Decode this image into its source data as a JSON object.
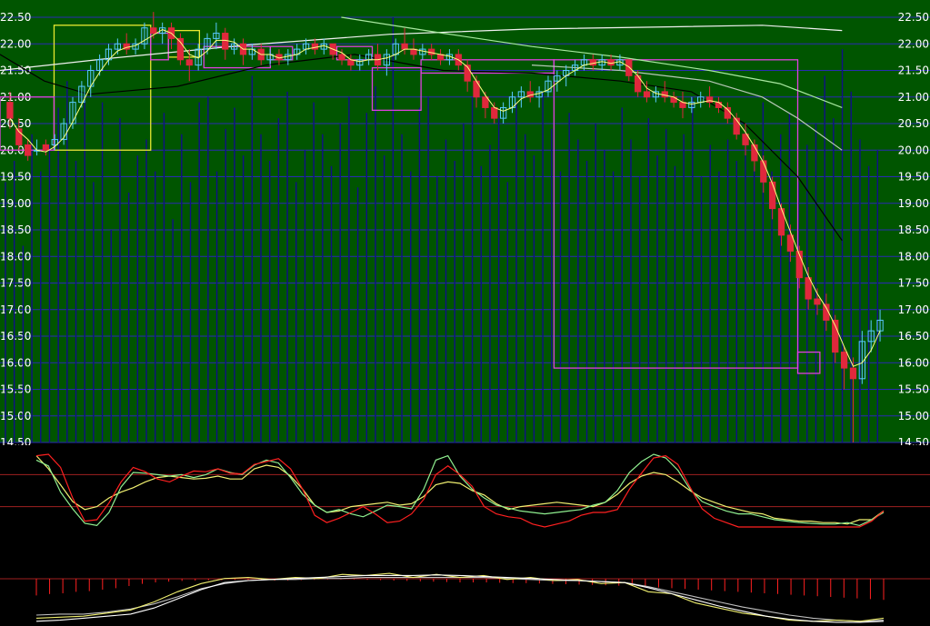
{
  "chart_data": {
    "type": "candlestick",
    "ylim": [
      14.5,
      22.5
    ],
    "grid": true,
    "yticks": [
      "14.50",
      "15.00",
      "15.50",
      "16.00",
      "16.50",
      "17.00",
      "17.50",
      "18.00",
      "18.50",
      "19.00",
      "19.50",
      "20.00",
      "20.50",
      "21.00",
      "21.50",
      "22.00",
      "22.50"
    ],
    "colors": {
      "background": "#005500",
      "gridline": "#2a2ab4",
      "candle_up": "#58c8ff",
      "candle_down": "#e0283c",
      "ma_white": "#f0f0f0",
      "ma_lightgreen": "#a8e8a0",
      "ma_black": "#000000",
      "ma_gray": "#b8c8b8",
      "ma_yellow": "#ffff80",
      "volume": "#101088",
      "box_yellow": "#e8e830",
      "box_magenta": "#e040e0",
      "osc_red": "#ff2020",
      "osc_green": "#90f090",
      "osc_yellow": "#f0f070",
      "osc_white": "#ffffff",
      "osc_refline": "#a02020"
    },
    "candles": [
      [
        20.9,
        21.1,
        20.6,
        20.4
      ],
      [
        20.4,
        20.6,
        20.1,
        20.0
      ],
      [
        20.1,
        20.2,
        19.9,
        19.8
      ],
      [
        20.0,
        20.2,
        20.0,
        19.9
      ],
      [
        20.1,
        20.2,
        20.0,
        19.9
      ],
      [
        20.1,
        20.3,
        20.2,
        20.0
      ],
      [
        20.2,
        20.6,
        20.5,
        20.1
      ],
      [
        20.5,
        21.0,
        20.9,
        20.4
      ],
      [
        20.9,
        21.3,
        21.2,
        20.8
      ],
      [
        21.2,
        21.6,
        21.5,
        21.0
      ],
      [
        21.5,
        21.8,
        21.7,
        21.4
      ],
      [
        21.7,
        22.0,
        21.9,
        21.6
      ],
      [
        21.9,
        22.1,
        22.0,
        21.8
      ],
      [
        22.0,
        22.2,
        21.9,
        21.8
      ],
      [
        21.9,
        22.1,
        22.0,
        21.8
      ],
      [
        22.0,
        22.4,
        22.3,
        21.9
      ],
      [
        22.3,
        22.6,
        22.2,
        22.1
      ],
      [
        22.2,
        22.4,
        22.3,
        22.0
      ],
      [
        22.3,
        22.4,
        22.1,
        21.9
      ],
      [
        22.1,
        22.2,
        21.7,
        21.6
      ],
      [
        21.7,
        21.9,
        21.6,
        21.3
      ],
      [
        21.6,
        22.0,
        21.9,
        21.5
      ],
      [
        21.9,
        22.2,
        22.1,
        21.8
      ],
      [
        22.1,
        22.4,
        22.2,
        21.9
      ],
      [
        22.2,
        22.3,
        21.9,
        21.7
      ],
      [
        21.9,
        22.1,
        22.0,
        21.8
      ],
      [
        22.0,
        22.1,
        21.8,
        21.6
      ],
      [
        21.8,
        22.0,
        21.9,
        21.7
      ],
      [
        21.9,
        22.0,
        21.7,
        21.6
      ],
      [
        21.7,
        21.9,
        21.8,
        21.6
      ],
      [
        21.8,
        21.9,
        21.7,
        21.6
      ],
      [
        21.7,
        21.9,
        21.8,
        21.6
      ],
      [
        21.8,
        22.0,
        21.9,
        21.7
      ],
      [
        21.9,
        22.1,
        22.0,
        21.8
      ],
      [
        22.0,
        22.1,
        21.9,
        21.8
      ],
      [
        21.9,
        22.1,
        22.0,
        21.8
      ],
      [
        22.0,
        22.0,
        21.8,
        21.7
      ],
      [
        21.8,
        21.9,
        21.7,
        21.6
      ],
      [
        21.7,
        21.8,
        21.6,
        21.5
      ],
      [
        21.6,
        21.8,
        21.7,
        21.5
      ],
      [
        21.7,
        21.9,
        21.8,
        21.6
      ],
      [
        21.8,
        22.0,
        21.6,
        21.5
      ],
      [
        21.6,
        21.9,
        21.8,
        21.4
      ],
      [
        21.8,
        22.1,
        22.0,
        21.7
      ],
      [
        22.0,
        22.3,
        21.9,
        21.8
      ],
      [
        21.9,
        22.1,
        21.8,
        21.7
      ],
      [
        21.8,
        22.0,
        21.9,
        21.7
      ],
      [
        21.9,
        22.0,
        21.8,
        21.7
      ],
      [
        21.8,
        21.9,
        21.7,
        21.6
      ],
      [
        21.7,
        21.9,
        21.8,
        21.6
      ],
      [
        21.8,
        21.9,
        21.6,
        21.5
      ],
      [
        21.6,
        21.7,
        21.3,
        21.1
      ],
      [
        21.3,
        21.4,
        21.0,
        20.8
      ],
      [
        21.0,
        21.1,
        20.8,
        20.6
      ],
      [
        20.8,
        20.9,
        20.6,
        20.5
      ],
      [
        20.6,
        20.9,
        20.8,
        20.5
      ],
      [
        20.8,
        21.1,
        21.0,
        20.7
      ],
      [
        21.0,
        21.2,
        21.1,
        20.8
      ],
      [
        21.1,
        21.3,
        21.0,
        20.9
      ],
      [
        21.0,
        21.2,
        21.1,
        20.8
      ],
      [
        21.1,
        21.4,
        21.3,
        21.0
      ],
      [
        21.3,
        21.5,
        21.4,
        21.1
      ],
      [
        21.4,
        21.6,
        21.5,
        21.2
      ],
      [
        21.5,
        21.7,
        21.6,
        21.4
      ],
      [
        21.6,
        21.8,
        21.7,
        21.5
      ],
      [
        21.7,
        21.8,
        21.6,
        21.5
      ],
      [
        21.6,
        21.8,
        21.7,
        21.5
      ],
      [
        21.7,
        21.8,
        21.6,
        21.5
      ],
      [
        21.6,
        21.8,
        21.7,
        21.5
      ],
      [
        21.7,
        21.7,
        21.4,
        21.3
      ],
      [
        21.4,
        21.5,
        21.1,
        21.0
      ],
      [
        21.1,
        21.3,
        21.0,
        20.9
      ],
      [
        21.0,
        21.2,
        21.1,
        20.9
      ],
      [
        21.1,
        21.3,
        21.0,
        20.9
      ],
      [
        21.0,
        21.1,
        20.9,
        20.8
      ],
      [
        20.9,
        21.1,
        20.8,
        20.6
      ],
      [
        20.8,
        21.0,
        20.9,
        20.7
      ],
      [
        20.9,
        21.1,
        21.0,
        20.8
      ],
      [
        21.0,
        21.2,
        20.9,
        20.8
      ],
      [
        20.9,
        21.0,
        20.8,
        20.7
      ],
      [
        20.8,
        20.9,
        20.6,
        20.5
      ],
      [
        20.6,
        20.7,
        20.3,
        20.2
      ],
      [
        20.3,
        20.5,
        20.1,
        19.9
      ],
      [
        20.1,
        20.2,
        19.8,
        19.6
      ],
      [
        19.8,
        19.9,
        19.4,
        19.2
      ],
      [
        19.4,
        19.5,
        18.9,
        18.7
      ],
      [
        18.9,
        19.0,
        18.4,
        18.2
      ],
      [
        18.4,
        18.6,
        18.1,
        17.9
      ],
      [
        18.1,
        18.2,
        17.6,
        17.4
      ],
      [
        17.6,
        17.8,
        17.2,
        17.0
      ],
      [
        17.2,
        17.4,
        17.1,
        16.9
      ],
      [
        17.1,
        17.3,
        16.8,
        16.6
      ],
      [
        16.8,
        16.9,
        16.2,
        16.0
      ],
      [
        16.2,
        16.3,
        15.9,
        15.5
      ],
      [
        15.9,
        16.1,
        15.7,
        14.5
      ],
      [
        15.7,
        16.6,
        16.4,
        15.6
      ],
      [
        16.4,
        16.8,
        16.6,
        16.2
      ],
      [
        16.6,
        17.0,
        16.8,
        16.4
      ]
    ],
    "volumes": [
      19.4,
      19.8,
      18.2,
      20.3,
      19.6,
      20.1,
      20.8,
      21.3,
      19.8,
      21.0,
      19.4,
      20.9,
      18.5,
      20.6,
      19.2,
      19.9,
      20.2,
      19.6,
      20.7,
      18.7,
      20.3,
      19.4,
      20.9,
      21.0,
      19.6,
      20.4,
      20.8,
      19.9,
      21.4,
      20.3,
      19.8,
      20.6,
      21.1,
      19.4,
      20.0,
      20.9,
      20.3,
      19.7,
      20.5,
      21.0,
      19.3,
      20.7,
      21.2,
      19.9,
      22.5,
      20.3,
      19.6,
      20.8,
      21.0,
      19.5,
      20.2,
      19.8,
      20.5,
      21.0,
      19.7,
      20.1,
      20.6,
      19.4,
      20.9,
      20.3,
      19.9,
      21.1,
      20.4,
      19.6,
      20.7,
      20.2,
      19.8,
      20.5,
      20.0,
      19.6,
      20.8,
      20.2,
      19.5,
      20.6,
      19.9,
      20.4,
      19.7,
      20.3,
      21.0,
      19.5,
      20.1,
      19.6,
      20.2,
      19.8,
      20.4,
      19.7,
      20.9,
      19.6,
      20.3,
      20.7,
      19.4,
      20.1,
      20.5,
      21.4,
      20.6,
      21.9,
      21.1,
      20.2,
      19.7,
      20.0
    ],
    "ma_lines": {
      "ma_white": [
        [
          0,
          21.5
        ],
        [
          0.12,
          21.72
        ],
        [
          0.28,
          21.98
        ],
        [
          0.44,
          22.18
        ],
        [
          0.6,
          22.28
        ],
        [
          0.76,
          22.32
        ],
        [
          0.86,
          22.35
        ],
        [
          0.95,
          22.25
        ]
      ],
      "ma_lightgreen": [
        [
          0.385,
          22.5
        ],
        [
          0.5,
          22.2
        ],
        [
          0.6,
          21.95
        ],
        [
          0.7,
          21.75
        ],
        [
          0.8,
          21.5
        ],
        [
          0.88,
          21.25
        ],
        [
          0.95,
          20.8
        ]
      ],
      "ma_gray": [
        [
          0.6,
          21.6
        ],
        [
          0.7,
          21.5
        ],
        [
          0.8,
          21.3
        ],
        [
          0.86,
          21.0
        ],
        [
          0.9,
          20.6
        ],
        [
          0.95,
          20.0
        ]
      ],
      "ma_black": [
        [
          0,
          21.8
        ],
        [
          0.05,
          21.3
        ],
        [
          0.1,
          21.05
        ],
        [
          0.2,
          21.2
        ],
        [
          0.3,
          21.6
        ],
        [
          0.4,
          21.8
        ],
        [
          0.5,
          21.5
        ],
        [
          0.6,
          21.45
        ],
        [
          0.7,
          21.3
        ],
        [
          0.78,
          21.1
        ],
        [
          0.84,
          20.5
        ],
        [
          0.9,
          19.5
        ],
        [
          0.95,
          18.3
        ]
      ]
    },
    "boxes": [
      {
        "color": "yellow",
        "x0": 0.061,
        "x1": 0.17,
        "y0": 22.35,
        "y1": 20.0
      },
      {
        "color": "yellow",
        "x0": 0.19,
        "x1": 0.225,
        "y0": 22.25,
        "y1": 21.75
      },
      {
        "color": "magenta",
        "x0": 0.0,
        "x1": 0.061,
        "y0": 21.0,
        "y1": 20.0
      },
      {
        "color": "magenta",
        "x0": 0.17,
        "x1": 0.19,
        "y0": 22.2,
        "y1": 21.7
      },
      {
        "color": "magenta",
        "x0": 0.23,
        "x1": 0.305,
        "y0": 21.95,
        "y1": 21.55
      },
      {
        "color": "magenta",
        "x0": 0.305,
        "x1": 0.33,
        "y0": 21.95,
        "y1": 21.7
      },
      {
        "color": "magenta",
        "x0": 0.38,
        "x1": 0.42,
        "y0": 21.95,
        "y1": 21.7
      },
      {
        "color": "magenta",
        "x0": 0.42,
        "x1": 0.475,
        "y0": 21.55,
        "y1": 20.75
      },
      {
        "color": "magenta",
        "x0": 0.475,
        "x1": 0.625,
        "y0": 21.7,
        "y1": 21.45
      },
      {
        "color": "magenta",
        "x0": 0.625,
        "x1": 0.9,
        "y0": 21.7,
        "y1": 15.9
      },
      {
        "color": "magenta",
        "x0": 0.9,
        "x1": 0.925,
        "y0": 16.2,
        "y1": 15.8
      }
    ],
    "indicator1": {
      "ref_lines": [
        0.28,
        0.72
      ],
      "red": [
        0.98,
        1.0,
        0.82,
        0.4,
        0.08,
        0.1,
        0.33,
        0.62,
        0.82,
        0.76,
        0.66,
        0.62,
        0.7,
        0.77,
        0.76,
        0.8,
        0.74,
        0.73,
        0.86,
        0.9,
        0.94,
        0.8,
        0.52,
        0.16,
        0.06,
        0.12,
        0.2,
        0.28,
        0.18,
        0.06,
        0.08,
        0.18,
        0.38,
        0.72,
        0.84,
        0.72,
        0.56,
        0.28,
        0.18,
        0.14,
        0.12,
        0.04,
        0.0,
        0.04,
        0.08,
        0.16,
        0.2,
        0.2,
        0.24,
        0.52,
        0.74,
        0.95,
        0.98,
        0.86,
        0.55,
        0.25,
        0.12,
        0.06,
        0.0,
        0.0,
        0.0,
        0.0,
        0.0,
        0.0,
        0.0,
        0.0,
        0.0,
        0.0,
        0.0,
        0.08,
        0.22
      ],
      "green": [
        0.92,
        0.84,
        0.48,
        0.25,
        0.05,
        0.02,
        0.2,
        0.55,
        0.75,
        0.74,
        0.72,
        0.7,
        0.72,
        0.68,
        0.72,
        0.8,
        0.75,
        0.72,
        0.85,
        0.92,
        0.88,
        0.68,
        0.45,
        0.3,
        0.2,
        0.24,
        0.18,
        0.14,
        0.22,
        0.3,
        0.28,
        0.25,
        0.52,
        0.92,
        0.98,
        0.7,
        0.52,
        0.4,
        0.3,
        0.26,
        0.22,
        0.2,
        0.18,
        0.2,
        0.22,
        0.24,
        0.3,
        0.34,
        0.5,
        0.75,
        0.9,
        1.0,
        0.95,
        0.78,
        0.52,
        0.35,
        0.28,
        0.22,
        0.18,
        0.18,
        0.14,
        0.1,
        0.08,
        0.06,
        0.05,
        0.04,
        0.04,
        0.06,
        0.02,
        0.1,
        0.2
      ],
      "yellow": [
        0.98,
        0.8,
        0.58,
        0.35,
        0.24,
        0.28,
        0.4,
        0.48,
        0.54,
        0.62,
        0.68,
        0.7,
        0.68,
        0.66,
        0.67,
        0.7,
        0.66,
        0.66,
        0.8,
        0.85,
        0.82,
        0.7,
        0.52,
        0.3,
        0.2,
        0.22,
        0.28,
        0.3,
        0.32,
        0.34,
        0.3,
        0.32,
        0.42,
        0.58,
        0.62,
        0.6,
        0.5,
        0.44,
        0.32,
        0.24,
        0.28,
        0.3,
        0.32,
        0.34,
        0.32,
        0.3,
        0.28,
        0.34,
        0.45,
        0.6,
        0.7,
        0.75,
        0.72,
        0.62,
        0.5,
        0.4,
        0.34,
        0.28,
        0.24,
        0.2,
        0.18,
        0.12,
        0.1,
        0.08,
        0.08,
        0.06,
        0.06,
        0.04,
        0.1,
        0.1,
        0.22
      ]
    },
    "indicator2": {
      "bars": [
        0.46,
        0.42,
        0.4,
        0.36,
        0.34,
        0.3,
        0.26,
        0.2,
        0.14,
        0.1,
        0.08,
        0.06,
        0.05,
        0.04,
        0.04,
        0.03,
        0.03,
        0.04,
        0.05,
        0.05,
        0.04,
        0.03,
        0.02,
        0.02,
        0.02,
        0.03,
        0.04,
        0.05,
        0.06,
        0.07,
        0.08,
        0.09,
        0.1,
        0.1,
        0.1,
        0.11,
        0.12,
        0.12,
        0.13,
        0.14,
        0.15,
        0.16,
        0.17,
        0.18,
        0.19,
        0.2,
        0.22,
        0.24,
        0.26,
        0.28,
        0.3,
        0.32,
        0.34,
        0.36,
        0.38,
        0.4,
        0.42,
        0.44,
        0.46,
        0.48,
        0.5,
        0.52,
        0.54,
        0.56,
        0.58
      ],
      "lines": {
        "white": [
          0.04,
          0.06,
          0.1,
          0.14,
          0.18,
          0.3,
          0.48,
          0.66,
          0.8,
          0.84,
          0.86,
          0.88,
          0.9,
          0.92,
          0.94,
          0.94,
          0.94,
          0.95,
          0.94,
          0.92,
          0.9,
          0.88,
          0.86,
          0.84,
          0.82,
          0.8,
          0.7,
          0.58,
          0.46,
          0.34,
          0.24,
          0.14,
          0.08,
          0.04,
          0.02,
          0.02,
          0.04
        ],
        "yellow": [
          0.1,
          0.12,
          0.14,
          0.2,
          0.26,
          0.42,
          0.62,
          0.78,
          0.88,
          0.9,
          0.86,
          0.9,
          0.88,
          0.96,
          0.94,
          0.98,
          0.9,
          0.96,
          0.9,
          0.94,
          0.86,
          0.9,
          0.84,
          0.86,
          0.78,
          0.8,
          0.62,
          0.58,
          0.4,
          0.3,
          0.2,
          0.14,
          0.06,
          0.04,
          0.06,
          0.04,
          0.1
        ],
        "gray": [
          0.16,
          0.18,
          0.18,
          0.22,
          0.28,
          0.38,
          0.52,
          0.68,
          0.78,
          0.84,
          0.86,
          0.86,
          0.88,
          0.88,
          0.9,
          0.9,
          0.9,
          0.9,
          0.9,
          0.9,
          0.88,
          0.86,
          0.84,
          0.84,
          0.82,
          0.8,
          0.72,
          0.62,
          0.52,
          0.42,
          0.32,
          0.24,
          0.16,
          0.1,
          0.06,
          0.04,
          0.06
        ]
      }
    }
  }
}
